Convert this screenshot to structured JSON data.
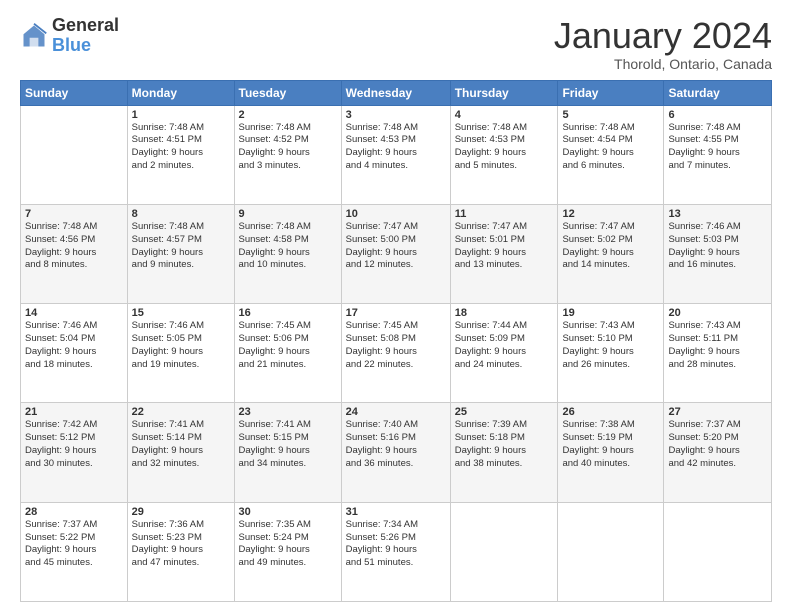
{
  "logo": {
    "general": "General",
    "blue": "Blue"
  },
  "header": {
    "month": "January 2024",
    "location": "Thorold, Ontario, Canada"
  },
  "weekdays": [
    "Sunday",
    "Monday",
    "Tuesday",
    "Wednesday",
    "Thursday",
    "Friday",
    "Saturday"
  ],
  "weeks": [
    [
      {
        "day": "",
        "info": ""
      },
      {
        "day": "1",
        "info": "Sunrise: 7:48 AM\nSunset: 4:51 PM\nDaylight: 9 hours\nand 2 minutes."
      },
      {
        "day": "2",
        "info": "Sunrise: 7:48 AM\nSunset: 4:52 PM\nDaylight: 9 hours\nand 3 minutes."
      },
      {
        "day": "3",
        "info": "Sunrise: 7:48 AM\nSunset: 4:53 PM\nDaylight: 9 hours\nand 4 minutes."
      },
      {
        "day": "4",
        "info": "Sunrise: 7:48 AM\nSunset: 4:53 PM\nDaylight: 9 hours\nand 5 minutes."
      },
      {
        "day": "5",
        "info": "Sunrise: 7:48 AM\nSunset: 4:54 PM\nDaylight: 9 hours\nand 6 minutes."
      },
      {
        "day": "6",
        "info": "Sunrise: 7:48 AM\nSunset: 4:55 PM\nDaylight: 9 hours\nand 7 minutes."
      }
    ],
    [
      {
        "day": "7",
        "info": "Sunrise: 7:48 AM\nSunset: 4:56 PM\nDaylight: 9 hours\nand 8 minutes."
      },
      {
        "day": "8",
        "info": "Sunrise: 7:48 AM\nSunset: 4:57 PM\nDaylight: 9 hours\nand 9 minutes."
      },
      {
        "day": "9",
        "info": "Sunrise: 7:48 AM\nSunset: 4:58 PM\nDaylight: 9 hours\nand 10 minutes."
      },
      {
        "day": "10",
        "info": "Sunrise: 7:47 AM\nSunset: 5:00 PM\nDaylight: 9 hours\nand 12 minutes."
      },
      {
        "day": "11",
        "info": "Sunrise: 7:47 AM\nSunset: 5:01 PM\nDaylight: 9 hours\nand 13 minutes."
      },
      {
        "day": "12",
        "info": "Sunrise: 7:47 AM\nSunset: 5:02 PM\nDaylight: 9 hours\nand 14 minutes."
      },
      {
        "day": "13",
        "info": "Sunrise: 7:46 AM\nSunset: 5:03 PM\nDaylight: 9 hours\nand 16 minutes."
      }
    ],
    [
      {
        "day": "14",
        "info": "Sunrise: 7:46 AM\nSunset: 5:04 PM\nDaylight: 9 hours\nand 18 minutes."
      },
      {
        "day": "15",
        "info": "Sunrise: 7:46 AM\nSunset: 5:05 PM\nDaylight: 9 hours\nand 19 minutes."
      },
      {
        "day": "16",
        "info": "Sunrise: 7:45 AM\nSunset: 5:06 PM\nDaylight: 9 hours\nand 21 minutes."
      },
      {
        "day": "17",
        "info": "Sunrise: 7:45 AM\nSunset: 5:08 PM\nDaylight: 9 hours\nand 22 minutes."
      },
      {
        "day": "18",
        "info": "Sunrise: 7:44 AM\nSunset: 5:09 PM\nDaylight: 9 hours\nand 24 minutes."
      },
      {
        "day": "19",
        "info": "Sunrise: 7:43 AM\nSunset: 5:10 PM\nDaylight: 9 hours\nand 26 minutes."
      },
      {
        "day": "20",
        "info": "Sunrise: 7:43 AM\nSunset: 5:11 PM\nDaylight: 9 hours\nand 28 minutes."
      }
    ],
    [
      {
        "day": "21",
        "info": "Sunrise: 7:42 AM\nSunset: 5:12 PM\nDaylight: 9 hours\nand 30 minutes."
      },
      {
        "day": "22",
        "info": "Sunrise: 7:41 AM\nSunset: 5:14 PM\nDaylight: 9 hours\nand 32 minutes."
      },
      {
        "day": "23",
        "info": "Sunrise: 7:41 AM\nSunset: 5:15 PM\nDaylight: 9 hours\nand 34 minutes."
      },
      {
        "day": "24",
        "info": "Sunrise: 7:40 AM\nSunset: 5:16 PM\nDaylight: 9 hours\nand 36 minutes."
      },
      {
        "day": "25",
        "info": "Sunrise: 7:39 AM\nSunset: 5:18 PM\nDaylight: 9 hours\nand 38 minutes."
      },
      {
        "day": "26",
        "info": "Sunrise: 7:38 AM\nSunset: 5:19 PM\nDaylight: 9 hours\nand 40 minutes."
      },
      {
        "day": "27",
        "info": "Sunrise: 7:37 AM\nSunset: 5:20 PM\nDaylight: 9 hours\nand 42 minutes."
      }
    ],
    [
      {
        "day": "28",
        "info": "Sunrise: 7:37 AM\nSunset: 5:22 PM\nDaylight: 9 hours\nand 45 minutes."
      },
      {
        "day": "29",
        "info": "Sunrise: 7:36 AM\nSunset: 5:23 PM\nDaylight: 9 hours\nand 47 minutes."
      },
      {
        "day": "30",
        "info": "Sunrise: 7:35 AM\nSunset: 5:24 PM\nDaylight: 9 hours\nand 49 minutes."
      },
      {
        "day": "31",
        "info": "Sunrise: 7:34 AM\nSunset: 5:26 PM\nDaylight: 9 hours\nand 51 minutes."
      },
      {
        "day": "",
        "info": ""
      },
      {
        "day": "",
        "info": ""
      },
      {
        "day": "",
        "info": ""
      }
    ]
  ]
}
